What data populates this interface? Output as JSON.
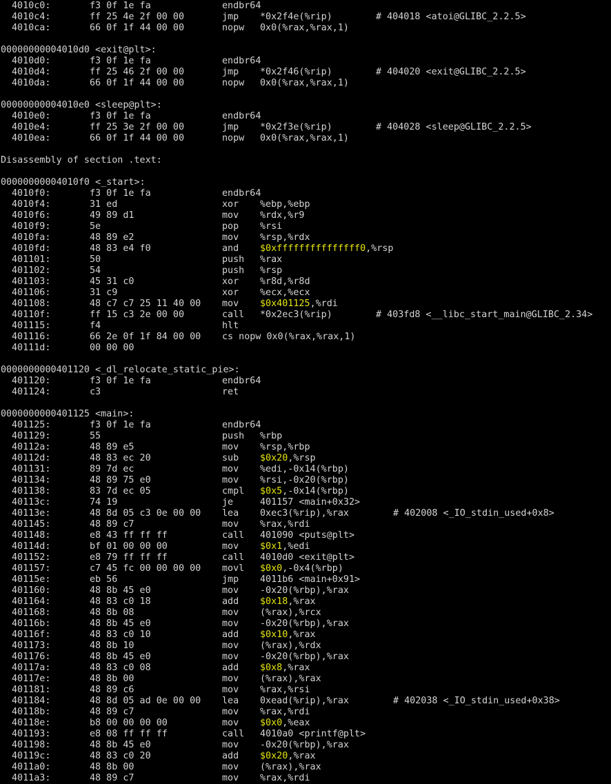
{
  "colors": {
    "background": "#000000",
    "text": "#d4d4d4",
    "immediate": "#e5e510"
  },
  "lines": [
    {
      "t": "i",
      "a": "4010c0:",
      "b": "f3 0f 1e fa",
      "m": "endbr64",
      "o": "",
      "c": ""
    },
    {
      "t": "i",
      "a": "4010c4:",
      "b": "ff 25 4e 2f 00 00",
      "m": "jmp",
      "o": "*0x2f4e(%rip)",
      "c": "# 404018 <atoi@GLIBC_2.2.5>"
    },
    {
      "t": "i",
      "a": "4010ca:",
      "b": "66 0f 1f 44 00 00",
      "m": "nopw",
      "o": "0x0(%rax,%rax,1)",
      "c": ""
    },
    {
      "t": "b"
    },
    {
      "t": "l",
      "text": "00000000004010d0 <exit@plt>:"
    },
    {
      "t": "i",
      "a": "4010d0:",
      "b": "f3 0f 1e fa",
      "m": "endbr64",
      "o": "",
      "c": ""
    },
    {
      "t": "i",
      "a": "4010d4:",
      "b": "ff 25 46 2f 00 00",
      "m": "jmp",
      "o": "*0x2f46(%rip)",
      "c": "# 404020 <exit@GLIBC_2.2.5>"
    },
    {
      "t": "i",
      "a": "4010da:",
      "b": "66 0f 1f 44 00 00",
      "m": "nopw",
      "o": "0x0(%rax,%rax,1)",
      "c": ""
    },
    {
      "t": "b"
    },
    {
      "t": "l",
      "text": "00000000004010e0 <sleep@plt>:"
    },
    {
      "t": "i",
      "a": "4010e0:",
      "b": "f3 0f 1e fa",
      "m": "endbr64",
      "o": "",
      "c": ""
    },
    {
      "t": "i",
      "a": "4010e4:",
      "b": "ff 25 3e 2f 00 00",
      "m": "jmp",
      "o": "*0x2f3e(%rip)",
      "c": "# 404028 <sleep@GLIBC_2.2.5>"
    },
    {
      "t": "i",
      "a": "4010ea:",
      "b": "66 0f 1f 44 00 00",
      "m": "nopw",
      "o": "0x0(%rax,%rax,1)",
      "c": ""
    },
    {
      "t": "b"
    },
    {
      "t": "l",
      "text": "Disassembly of section .text:"
    },
    {
      "t": "b"
    },
    {
      "t": "l",
      "text": "00000000004010f0 <_start>:"
    },
    {
      "t": "i",
      "a": "4010f0:",
      "b": "f3 0f 1e fa",
      "m": "endbr64",
      "o": "",
      "c": ""
    },
    {
      "t": "i",
      "a": "4010f4:",
      "b": "31 ed",
      "m": "xor",
      "o": "%ebp,%ebp",
      "c": ""
    },
    {
      "t": "i",
      "a": "4010f6:",
      "b": "49 89 d1",
      "m": "mov",
      "o": "%rdx,%r9",
      "c": ""
    },
    {
      "t": "i",
      "a": "4010f9:",
      "b": "5e",
      "m": "pop",
      "o": "%rsi",
      "c": ""
    },
    {
      "t": "i",
      "a": "4010fa:",
      "b": "48 89 e2",
      "m": "mov",
      "o": "%rsp,%rdx",
      "c": ""
    },
    {
      "t": "i",
      "a": "4010fd:",
      "b": "48 83 e4 f0",
      "m": "and",
      "oi": "$0xfffffffffffffff0",
      "or": ",%rsp",
      "c": ""
    },
    {
      "t": "i",
      "a": "401101:",
      "b": "50",
      "m": "push",
      "o": "%rax",
      "c": ""
    },
    {
      "t": "i",
      "a": "401102:",
      "b": "54",
      "m": "push",
      "o": "%rsp",
      "c": ""
    },
    {
      "t": "i",
      "a": "401103:",
      "b": "45 31 c0",
      "m": "xor",
      "o": "%r8d,%r8d",
      "c": ""
    },
    {
      "t": "i",
      "a": "401106:",
      "b": "31 c9",
      "m": "xor",
      "o": "%ecx,%ecx",
      "c": ""
    },
    {
      "t": "i",
      "a": "401108:",
      "b": "48 c7 c7 25 11 40 00",
      "m": "mov",
      "oi": "$0x401125",
      "or": ",%rdi",
      "c": ""
    },
    {
      "t": "i",
      "a": "40110f:",
      "b": "ff 15 c3 2e 00 00",
      "m": "call",
      "o": "*0x2ec3(%rip)",
      "c": "# 403fd8 <__libc_start_main@GLIBC_2.34>"
    },
    {
      "t": "i",
      "a": "401115:",
      "b": "f4",
      "m": "hlt",
      "o": "",
      "c": ""
    },
    {
      "t": "i",
      "a": "401116:",
      "b": "66 2e 0f 1f 84 00 00",
      "m": "cs nopw 0x0(%rax,%rax,1)",
      "o": "",
      "c": ""
    },
    {
      "t": "i",
      "a": "40111d:",
      "b": "00 00 00",
      "m": "",
      "o": "",
      "c": ""
    },
    {
      "t": "b"
    },
    {
      "t": "l",
      "text": "0000000000401120 <_dl_relocate_static_pie>:"
    },
    {
      "t": "i",
      "a": "401120:",
      "b": "f3 0f 1e fa",
      "m": "endbr64",
      "o": "",
      "c": ""
    },
    {
      "t": "i",
      "a": "401124:",
      "b": "c3",
      "m": "ret",
      "o": "",
      "c": ""
    },
    {
      "t": "b"
    },
    {
      "t": "l",
      "text": "0000000000401125 <main>:"
    },
    {
      "t": "i",
      "a": "401125:",
      "b": "f3 0f 1e fa",
      "m": "endbr64",
      "o": "",
      "c": ""
    },
    {
      "t": "i",
      "a": "401129:",
      "b": "55",
      "m": "push",
      "o": "%rbp",
      "c": ""
    },
    {
      "t": "i",
      "a": "40112a:",
      "b": "48 89 e5",
      "m": "mov",
      "o": "%rsp,%rbp",
      "c": ""
    },
    {
      "t": "i",
      "a": "40112d:",
      "b": "48 83 ec 20",
      "m": "sub",
      "oi": "$0x20",
      "or": ",%rsp",
      "c": ""
    },
    {
      "t": "i",
      "a": "401131:",
      "b": "89 7d ec",
      "m": "mov",
      "o": "%edi,-0x14(%rbp)",
      "c": ""
    },
    {
      "t": "i",
      "a": "401134:",
      "b": "48 89 75 e0",
      "m": "mov",
      "o": "%rsi,-0x20(%rbp)",
      "c": ""
    },
    {
      "t": "i",
      "a": "401138:",
      "b": "83 7d ec 05",
      "m": "cmpl",
      "oi": "$0x5",
      "or": ",-0x14(%rbp)",
      "c": ""
    },
    {
      "t": "i",
      "a": "40113c:",
      "b": "74 19",
      "m": "je",
      "o": "401157 <main+0x32>",
      "c": ""
    },
    {
      "t": "i",
      "a": "40113e:",
      "b": "48 8d 05 c3 0e 00 00",
      "m": "lea",
      "o": "0xec3(%rip),%rax",
      "c2": "# 402008 <_IO_stdin_used+0x8>"
    },
    {
      "t": "i",
      "a": "401145:",
      "b": "48 89 c7",
      "m": "mov",
      "o": "%rax,%rdi",
      "c": ""
    },
    {
      "t": "i",
      "a": "401148:",
      "b": "e8 43 ff ff ff",
      "m": "call",
      "o": "401090 <puts@plt>",
      "c": ""
    },
    {
      "t": "i",
      "a": "40114d:",
      "b": "bf 01 00 00 00",
      "m": "mov",
      "oi": "$0x1",
      "or": ",%edi",
      "c": ""
    },
    {
      "t": "i",
      "a": "401152:",
      "b": "e8 79 ff ff ff",
      "m": "call",
      "o": "4010d0 <exit@plt>",
      "c": ""
    },
    {
      "t": "i",
      "a": "401157:",
      "b": "c7 45 fc 00 00 00 00",
      "m": "movl",
      "oi": "$0x0",
      "or": ",-0x4(%rbp)",
      "c": ""
    },
    {
      "t": "i",
      "a": "40115e:",
      "b": "eb 56",
      "m": "jmp",
      "o": "4011b6 <main+0x91>",
      "c": ""
    },
    {
      "t": "i",
      "a": "401160:",
      "b": "48 8b 45 e0",
      "m": "mov",
      "o": "-0x20(%rbp),%rax",
      "c": ""
    },
    {
      "t": "i",
      "a": "401164:",
      "b": "48 83 c0 18",
      "m": "add",
      "oi": "$0x18",
      "or": ",%rax",
      "c": ""
    },
    {
      "t": "i",
      "a": "401168:",
      "b": "48 8b 08",
      "m": "mov",
      "o": "(%rax),%rcx",
      "c": ""
    },
    {
      "t": "i",
      "a": "40116b:",
      "b": "48 8b 45 e0",
      "m": "mov",
      "o": "-0x20(%rbp),%rax",
      "c": ""
    },
    {
      "t": "i",
      "a": "40116f:",
      "b": "48 83 c0 10",
      "m": "add",
      "oi": "$0x10",
      "or": ",%rax",
      "c": ""
    },
    {
      "t": "i",
      "a": "401173:",
      "b": "48 8b 10",
      "m": "mov",
      "o": "(%rax),%rdx",
      "c": ""
    },
    {
      "t": "i",
      "a": "401176:",
      "b": "48 8b 45 e0",
      "m": "mov",
      "o": "-0x20(%rbp),%rax",
      "c": ""
    },
    {
      "t": "i",
      "a": "40117a:",
      "b": "48 83 c0 08",
      "m": "add",
      "oi": "$0x8",
      "or": ",%rax",
      "c": ""
    },
    {
      "t": "i",
      "a": "40117e:",
      "b": "48 8b 00",
      "m": "mov",
      "o": "(%rax),%rax",
      "c": ""
    },
    {
      "t": "i",
      "a": "401181:",
      "b": "48 89 c6",
      "m": "mov",
      "o": "%rax,%rsi",
      "c": ""
    },
    {
      "t": "i",
      "a": "401184:",
      "b": "48 8d 05 ad 0e 00 00",
      "m": "lea",
      "o": "0xead(%rip),%rax",
      "c2": "# 402038 <_IO_stdin_used+0x38>"
    },
    {
      "t": "i",
      "a": "40118b:",
      "b": "48 89 c7",
      "m": "mov",
      "o": "%rax,%rdi",
      "c": ""
    },
    {
      "t": "i",
      "a": "40118e:",
      "b": "b8 00 00 00 00",
      "m": "mov",
      "oi": "$0x0",
      "or": ",%eax",
      "c": ""
    },
    {
      "t": "i",
      "a": "401193:",
      "b": "e8 08 ff ff ff",
      "m": "call",
      "o": "4010a0 <printf@plt>",
      "c": ""
    },
    {
      "t": "i",
      "a": "401198:",
      "b": "48 8b 45 e0",
      "m": "mov",
      "o": "-0x20(%rbp),%rax",
      "c": ""
    },
    {
      "t": "i",
      "a": "40119c:",
      "b": "48 83 c0 20",
      "m": "add",
      "oi": "$0x20",
      "or": ",%rax",
      "c": ""
    },
    {
      "t": "i",
      "a": "4011a0:",
      "b": "48 8b 00",
      "m": "mov",
      "o": "(%rax),%rax",
      "c": ""
    },
    {
      "t": "i",
      "a": "4011a3:",
      "b": "48 89 c7",
      "m": "mov",
      "o": "%rax,%rdi",
      "c": ""
    }
  ]
}
